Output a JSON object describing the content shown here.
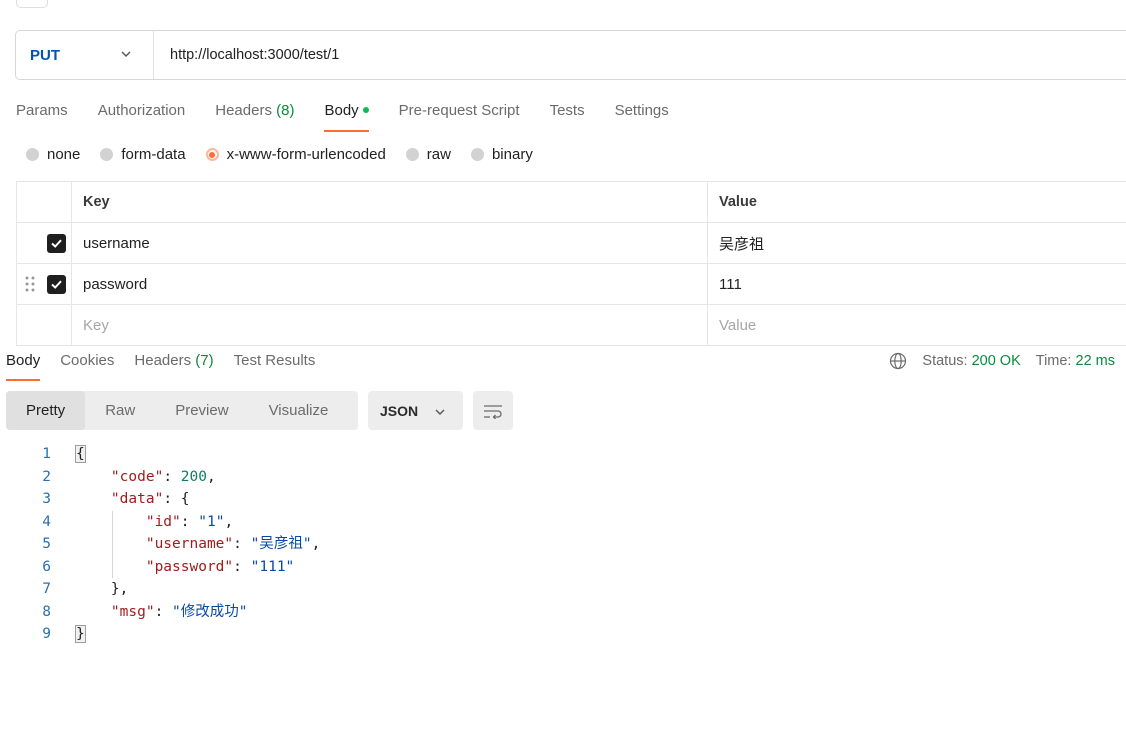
{
  "request": {
    "method": "PUT",
    "url": "http://localhost:3000/test/1"
  },
  "request_tabs": [
    {
      "label": "Params",
      "count": ""
    },
    {
      "label": "Authorization",
      "count": ""
    },
    {
      "label": "Headers",
      "count": "(8)"
    },
    {
      "label": "Body",
      "count": "",
      "active": true
    },
    {
      "label": "Pre-request Script",
      "count": ""
    },
    {
      "label": "Tests",
      "count": ""
    },
    {
      "label": "Settings",
      "count": ""
    }
  ],
  "body_types": [
    {
      "label": "none",
      "checked": false
    },
    {
      "label": "form-data",
      "checked": false
    },
    {
      "label": "x-www-form-urlencoded",
      "checked": true
    },
    {
      "label": "raw",
      "checked": false
    },
    {
      "label": "binary",
      "checked": false
    }
  ],
  "params_table": {
    "headers": {
      "key": "Key",
      "value": "Value"
    },
    "rows": [
      {
        "key": "username",
        "value": "吴彦祖",
        "checked": true
      },
      {
        "key": "password",
        "value": "111",
        "checked": true
      }
    ],
    "placeholder": {
      "key": "Key",
      "value": "Value"
    }
  },
  "response_tabs": [
    {
      "label": "Body",
      "count": "",
      "active": true
    },
    {
      "label": "Cookies",
      "count": ""
    },
    {
      "label": "Headers",
      "count": "(7)"
    },
    {
      "label": "Test Results",
      "count": ""
    }
  ],
  "response_status": {
    "status_label": "Status:",
    "status_value": "200 OK",
    "time_label": "Time:",
    "time_value": "22 ms"
  },
  "view_modes": [
    "Pretty",
    "Raw",
    "Preview",
    "Visualize"
  ],
  "active_view_mode": "Pretty",
  "format": "JSON",
  "code_lines": [
    {
      "n": "1",
      "text": "{"
    },
    {
      "n": "2",
      "text": "    \"code\": 200,"
    },
    {
      "n": "3",
      "text": "    \"data\": {"
    },
    {
      "n": "4",
      "text": "        \"id\": \"1\","
    },
    {
      "n": "5",
      "text": "        \"username\": \"吴彦祖\","
    },
    {
      "n": "6",
      "text": "        \"password\": \"111\""
    },
    {
      "n": "7",
      "text": "    },"
    },
    {
      "n": "8",
      "text": "    \"msg\": \"修改成功\""
    },
    {
      "n": "9",
      "text": "}"
    }
  ],
  "colors": {
    "accent": "#ff6c37",
    "method": "#0053b8",
    "success": "#0b8a3c",
    "json_key": "#a11d1d",
    "json_string": "#0a4aa6",
    "json_number": "#0b7f63"
  }
}
